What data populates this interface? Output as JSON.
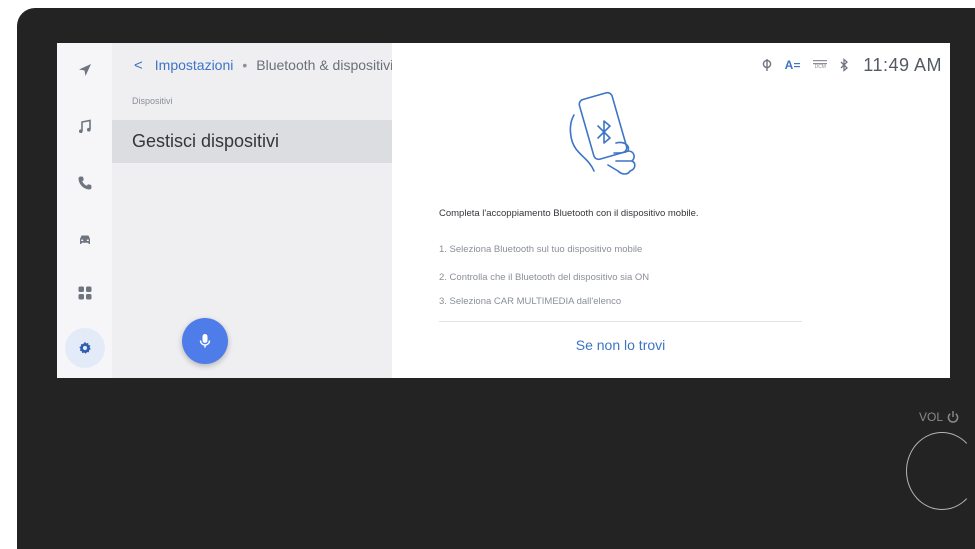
{
  "header": {
    "back_glyph": "<",
    "parent": "Impostazioni",
    "separator": "•",
    "current": "Bluetooth & dispositivi"
  },
  "list": {
    "section_label": "Dispositivi",
    "items": [
      {
        "label": "Gestisci dispositivi",
        "selected": true
      }
    ]
  },
  "rail": {
    "items": [
      {
        "icon": "navigation-arrow-icon",
        "active": false
      },
      {
        "icon": "music-note-icon",
        "active": false
      },
      {
        "icon": "phone-icon",
        "active": false
      },
      {
        "icon": "car-icon",
        "active": false
      },
      {
        "icon": "apps-grid-icon",
        "active": false
      },
      {
        "icon": "gear-icon",
        "active": true
      }
    ]
  },
  "status_bar": {
    "icons": [
      "signal-antenna-icon",
      "font-size-icon",
      "dcm-icon",
      "bluetooth-icon"
    ],
    "dcm_text": "DCM",
    "font_text": "A",
    "time": "11:49 AM"
  },
  "content": {
    "illustration": "phone-bluetooth-icon",
    "instruction": "Completa l'accoppiamento Bluetooth con il dispositivo mobile.",
    "steps": [
      "1. Seleziona Bluetooth sul tuo dispositivo mobile",
      "2. Controlla che il Bluetooth del dispositivo sia ON",
      "3. Seleziona CAR MULTIMEDIA dall'elenco"
    ],
    "link": "Se non lo trovi"
  },
  "hardware": {
    "knob_label": "VOL"
  },
  "colors": {
    "accent": "#3d74c6",
    "mic_button": "#4e7de9",
    "bezel": "#232323"
  }
}
